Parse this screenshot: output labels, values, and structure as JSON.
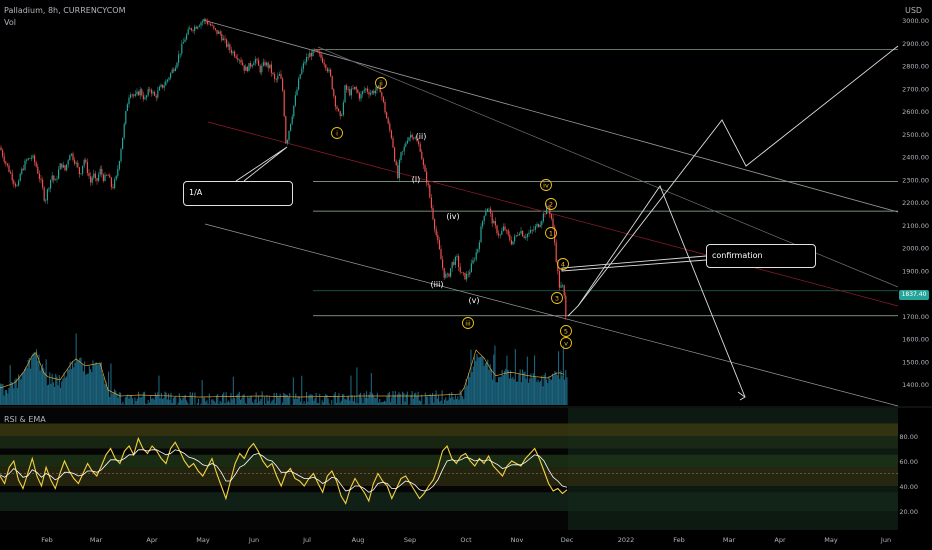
{
  "header": {
    "title": "Palladium, 8h, CURRENCYCOM",
    "volume_label": "Vol",
    "currency": "USD",
    "rsi_title": "RSI & EMA"
  },
  "price_badge": "1837.40",
  "colors": {
    "up": "#26a69a",
    "down": "#ef5350",
    "volume": "#1f6f8b",
    "wave_label": "#f0c419",
    "trend_line": "#9a9a9a",
    "red_line": "#8b1c2a",
    "rsi_line": "#f4d03f",
    "ema_line": "#ffffff",
    "rsi_band": "#3a3a10"
  },
  "chart_data": [
    {
      "type": "candlestick",
      "title": "Palladium, 8h, CURRENCYCOM",
      "ylabel": "USD",
      "ylim": [
        1300,
        3000
      ],
      "y_ticks": [
        "3000.00",
        "2900.00",
        "2800.00",
        "2700.00",
        "2600.00",
        "2500.00",
        "2400.00",
        "2300.00",
        "2200.00",
        "2100.00",
        "2000.00",
        "1900.00",
        "1800.00",
        "1700.00",
        "1600.00",
        "1500.00",
        "1400.00"
      ],
      "x_ticks": [
        "Feb",
        "Mar",
        "Apr",
        "May",
        "Jun",
        "Jul",
        "Aug",
        "Sep",
        "Oct",
        "Nov",
        "Dec",
        "2022",
        "Feb",
        "Mar",
        "Apr",
        "May",
        "Jun"
      ],
      "price_path": [
        [
          0,
          2440
        ],
        [
          5,
          2380
        ],
        [
          10,
          2330
        ],
        [
          14,
          2290
        ],
        [
          18,
          2260
        ],
        [
          20,
          2320
        ],
        [
          26,
          2380
        ],
        [
          32,
          2400
        ],
        [
          36,
          2360
        ],
        [
          40,
          2300
        ],
        [
          43,
          2250
        ],
        [
          45,
          2200
        ],
        [
          48,
          2260
        ],
        [
          52,
          2320
        ],
        [
          55,
          2280
        ],
        [
          58,
          2330
        ],
        [
          61,
          2370
        ],
        [
          65,
          2340
        ],
        [
          70,
          2420
        ],
        [
          75,
          2380
        ],
        [
          80,
          2320
        ],
        [
          84,
          2390
        ],
        [
          88,
          2330
        ],
        [
          91,
          2280
        ],
        [
          93,
          2330
        ],
        [
          96,
          2280
        ],
        [
          100,
          2340
        ],
        [
          104,
          2300
        ],
        [
          108,
          2320
        ],
        [
          112,
          2260
        ],
        [
          116,
          2300
        ],
        [
          119,
          2380
        ],
        [
          122,
          2470
        ],
        [
          125,
          2560
        ],
        [
          127,
          2630
        ],
        [
          130,
          2690
        ],
        [
          135,
          2660
        ],
        [
          140,
          2690
        ],
        [
          145,
          2650
        ],
        [
          150,
          2700
        ],
        [
          155,
          2660
        ],
        [
          160,
          2700
        ],
        [
          165,
          2720
        ],
        [
          170,
          2760
        ],
        [
          175,
          2800
        ],
        [
          180,
          2860
        ],
        [
          185,
          2920
        ],
        [
          190,
          2960
        ],
        [
          195,
          2970
        ],
        [
          200,
          2990
        ],
        [
          205,
          3000
        ],
        [
          210,
          2980
        ],
        [
          215,
          2950
        ],
        [
          220,
          2940
        ],
        [
          225,
          2900
        ],
        [
          230,
          2870
        ],
        [
          235,
          2850
        ],
        [
          240,
          2830
        ],
        [
          245,
          2780
        ],
        [
          250,
          2800
        ],
        [
          255,
          2830
        ],
        [
          260,
          2780
        ],
        [
          265,
          2810
        ],
        [
          270,
          2790
        ],
        [
          275,
          2730
        ],
        [
          280,
          2760
        ],
        [
          283,
          2680
        ],
        [
          286,
          2450
        ],
        [
          290,
          2540
        ],
        [
          295,
          2650
        ],
        [
          300,
          2760
        ],
        [
          305,
          2820
        ],
        [
          310,
          2850
        ],
        [
          315,
          2860
        ],
        [
          320,
          2840
        ],
        [
          325,
          2810
        ],
        [
          330,
          2760
        ],
        [
          335,
          2640
        ],
        [
          338,
          2600
        ],
        [
          340,
          2560
        ],
        [
          343,
          2620
        ],
        [
          345,
          2700
        ],
        [
          350,
          2680
        ],
        [
          355,
          2700
        ],
        [
          360,
          2660
        ],
        [
          365,
          2700
        ],
        [
          370,
          2680
        ],
        [
          375,
          2690
        ],
        [
          380,
          2700
        ],
        [
          384,
          2620
        ],
        [
          388,
          2540
        ],
        [
          392,
          2480
        ],
        [
          395,
          2380
        ],
        [
          398,
          2300
        ],
        [
          400,
          2400
        ],
        [
          403,
          2420
        ],
        [
          407,
          2480
        ],
        [
          412,
          2500
        ],
        [
          416,
          2470
        ],
        [
          420,
          2440
        ],
        [
          424,
          2340
        ],
        [
          428,
          2270
        ],
        [
          432,
          2160
        ],
        [
          436,
          2060
        ],
        [
          440,
          1970
        ],
        [
          444,
          1880
        ],
        [
          448,
          1870
        ],
        [
          452,
          1930
        ],
        [
          457,
          1950
        ],
        [
          461,
          1880
        ],
        [
          466,
          1870
        ],
        [
          470,
          1900
        ],
        [
          474,
          1950
        ],
        [
          478,
          2000
        ],
        [
          481,
          2080
        ],
        [
          484,
          2150
        ],
        [
          488,
          2180
        ],
        [
          492,
          2120
        ],
        [
          496,
          2080
        ],
        [
          500,
          2050
        ],
        [
          504,
          2090
        ],
        [
          508,
          2050
        ],
        [
          512,
          2020
        ],
        [
          516,
          2050
        ],
        [
          520,
          2080
        ],
        [
          524,
          2050
        ],
        [
          528,
          2060
        ],
        [
          532,
          2070
        ],
        [
          536,
          2090
        ],
        [
          540,
          2110
        ],
        [
          544,
          2150
        ],
        [
          548,
          2180
        ],
        [
          551,
          2140
        ],
        [
          554,
          2050
        ],
        [
          556,
          1960
        ],
        [
          558,
          1880
        ],
        [
          560,
          1810
        ],
        [
          562,
          1840
        ],
        [
          564,
          1790
        ],
        [
          566,
          1700
        ],
        [
          568,
          1760
        ]
      ],
      "horizontal_levels": [
        2870,
        2290,
        2160,
        1810,
        1700
      ],
      "wave_labels": [
        {
          "text": "i",
          "price": 2550,
          "style": "circle"
        },
        {
          "text": "ii",
          "price": 2820,
          "style": "circle"
        },
        {
          "text": "(i)",
          "price": 2315,
          "style": "plain"
        },
        {
          "text": "(ii)",
          "price": 2545,
          "style": "plain"
        },
        {
          "text": "(iii)",
          "price": 1845,
          "style": "plain"
        },
        {
          "text": "(iv)",
          "price": 2140,
          "style": "plain"
        },
        {
          "text": "(v)",
          "price": 1787,
          "style": "plain"
        },
        {
          "text": "iii",
          "price": 1690,
          "style": "circle"
        },
        {
          "text": "iv",
          "price": 2280,
          "style": "circle"
        },
        {
          "text": "2",
          "price": 2195,
          "style": "circle"
        },
        {
          "text": "1",
          "price": 2065,
          "style": "circle"
        },
        {
          "text": "4",
          "price": 1908,
          "style": "circle"
        },
        {
          "text": "3",
          "price": 1780,
          "style": "circle"
        },
        {
          "text": "5",
          "price": 1640,
          "style": "circle"
        },
        {
          "text": "v",
          "price": 1595,
          "style": "circle"
        }
      ],
      "callouts": [
        {
          "text": "1/A",
          "anchor_price": 2450
        },
        {
          "text": "confirmation",
          "anchor_price": 1910
        }
      ]
    },
    {
      "type": "line",
      "title": "RSI & EMA",
      "ylim": [
        10,
        95
      ],
      "y_ticks": [
        "80.00",
        "60.00",
        "40.00",
        "20.00"
      ],
      "series": [
        {
          "key": "rsi",
          "values": [
            48,
            42,
            55,
            60,
            45,
            38,
            50,
            62,
            48,
            40,
            55,
            45,
            38,
            50,
            60,
            52,
            46,
            42,
            50,
            58,
            52,
            48,
            56,
            65,
            70,
            62,
            58,
            68,
            72,
            65,
            78,
            70,
            66,
            72,
            68,
            62,
            58,
            70,
            75,
            68,
            60,
            55,
            58,
            52,
            48,
            55,
            62,
            50,
            40,
            30,
            44,
            58,
            66,
            62,
            70,
            74,
            68,
            60,
            55,
            58,
            48,
            40,
            50,
            54,
            46,
            44,
            40,
            46,
            50,
            42,
            35,
            48,
            52,
            44,
            32,
            26,
            38,
            46,
            40,
            35,
            28,
            42,
            50,
            44,
            40,
            30,
            38,
            46,
            48,
            42,
            36,
            30,
            34,
            40,
            45,
            55,
            68,
            72,
            62,
            58,
            64,
            66,
            60,
            56,
            62,
            58,
            64,
            56,
            52,
            48,
            56,
            60,
            58,
            56,
            62,
            66,
            70,
            62,
            52,
            42,
            36,
            38,
            34,
            37
          ]
        },
        {
          "key": "ema",
          "values": [
            49,
            47,
            50,
            54,
            51,
            47,
            48,
            53,
            51,
            47,
            50,
            48,
            45,
            47,
            51,
            51,
            50,
            48,
            49,
            52,
            52,
            51,
            53,
            57,
            61,
            61,
            60,
            62,
            65,
            65,
            69,
            69,
            68,
            69,
            69,
            67,
            65,
            66,
            69,
            68,
            66,
            63,
            62,
            60,
            57,
            56,
            58,
            56,
            51,
            44,
            44,
            49,
            55,
            57,
            61,
            65,
            66,
            64,
            61,
            60,
            56,
            51,
            51,
            52,
            50,
            48,
            46,
            46,
            47,
            45,
            42,
            44,
            47,
            46,
            41,
            36,
            37,
            40,
            40,
            38,
            35,
            37,
            42,
            43,
            42,
            38,
            38,
            41,
            44,
            43,
            41,
            37,
            36,
            37,
            40,
            45,
            53,
            60,
            61,
            60,
            61,
            63,
            62,
            60,
            61,
            60,
            61,
            59,
            57,
            54,
            55,
            57,
            57,
            57,
            59,
            62,
            65,
            64,
            60,
            53,
            47,
            44,
            40,
            39
          ]
        }
      ]
    }
  ]
}
